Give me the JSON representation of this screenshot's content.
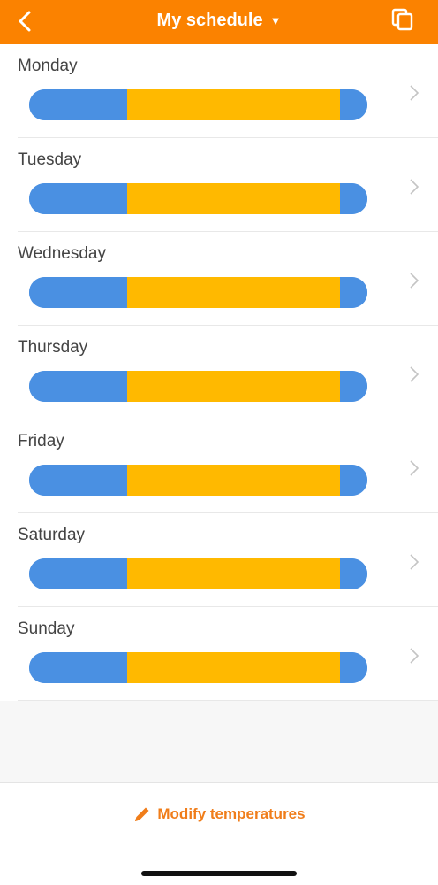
{
  "header": {
    "title": "My schedule",
    "caret": "▼",
    "back_icon": "chevron-left-icon",
    "copy_icon": "copy-icon"
  },
  "colors": {
    "header_bg": "#fb8200",
    "cold": "#4a90e2",
    "warm": "#ffb900",
    "accent": "#f07d1a"
  },
  "days": [
    {
      "name": "Monday",
      "segments": [
        {
          "mode": "cold",
          "fraction": 0.29
        },
        {
          "mode": "warm",
          "fraction": 0.63
        },
        {
          "mode": "cold",
          "fraction": 0.08
        }
      ]
    },
    {
      "name": "Tuesday",
      "segments": [
        {
          "mode": "cold",
          "fraction": 0.29
        },
        {
          "mode": "warm",
          "fraction": 0.63
        },
        {
          "mode": "cold",
          "fraction": 0.08
        }
      ]
    },
    {
      "name": "Wednesday",
      "segments": [
        {
          "mode": "cold",
          "fraction": 0.29
        },
        {
          "mode": "warm",
          "fraction": 0.63
        },
        {
          "mode": "cold",
          "fraction": 0.08
        }
      ]
    },
    {
      "name": "Thursday",
      "segments": [
        {
          "mode": "cold",
          "fraction": 0.29
        },
        {
          "mode": "warm",
          "fraction": 0.63
        },
        {
          "mode": "cold",
          "fraction": 0.08
        }
      ]
    },
    {
      "name": "Friday",
      "segments": [
        {
          "mode": "cold",
          "fraction": 0.29
        },
        {
          "mode": "warm",
          "fraction": 0.63
        },
        {
          "mode": "cold",
          "fraction": 0.08
        }
      ]
    },
    {
      "name": "Saturday",
      "segments": [
        {
          "mode": "cold",
          "fraction": 0.29
        },
        {
          "mode": "warm",
          "fraction": 0.63
        },
        {
          "mode": "cold",
          "fraction": 0.08
        }
      ]
    },
    {
      "name": "Sunday",
      "segments": [
        {
          "mode": "cold",
          "fraction": 0.29
        },
        {
          "mode": "warm",
          "fraction": 0.63
        },
        {
          "mode": "cold",
          "fraction": 0.08
        }
      ]
    }
  ],
  "footer": {
    "modify_label": "Modify temperatures",
    "modify_icon": "pencil-icon"
  }
}
